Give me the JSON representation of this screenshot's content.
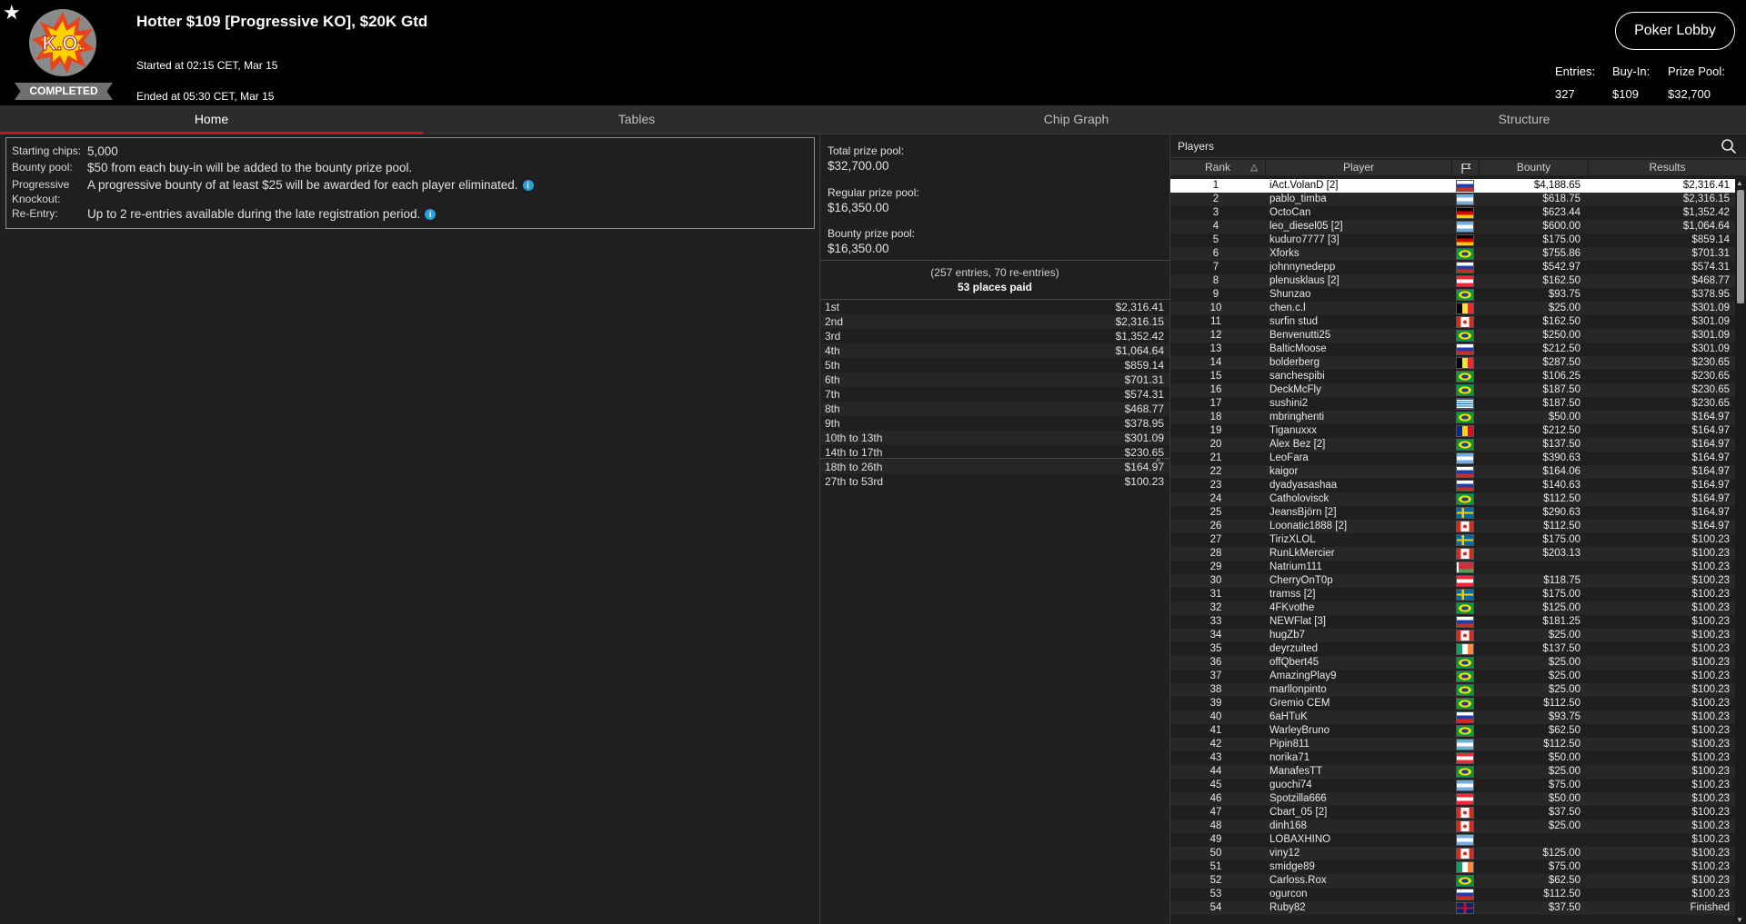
{
  "header": {
    "title": "Hotter $109 [Progressive KO], $20K Gtd",
    "started": "Started at 02:15 CET, Mar 15",
    "ended": "Ended at 05:30 CET, Mar 15",
    "status": "COMPLETED",
    "logo_text": "K.O.",
    "lobby_button": "Poker Lobby",
    "entries_label": "Entries:",
    "entries_value": "327",
    "buyin_label": "Buy-In:",
    "buyin_value": "$109",
    "prizepool_label": "Prize Pool:",
    "prizepool_value": "$32,700"
  },
  "tabs": [
    {
      "label": "Home",
      "active": true
    },
    {
      "label": "Tables",
      "active": false
    },
    {
      "label": "Chip Graph",
      "active": false
    },
    {
      "label": "Structure",
      "active": false
    }
  ],
  "info": {
    "starting_chips_label": "Starting chips:",
    "starting_chips_value": "5,000",
    "bounty_pool_label": "Bounty pool:",
    "bounty_pool_value": "$50 from each buy-in will be added to the bounty prize pool.",
    "pko_label_1": "Progressive",
    "pko_label_2": "Knockout:",
    "pko_value": "A progressive bounty of at least $25 will be awarded for each player eliminated.",
    "reentry_label": "Re-Entry:",
    "reentry_value": "Up to 2 re-entries available during the late registration period.",
    "info_icon": "i"
  },
  "prize": {
    "total_label": "Total prize pool:",
    "total_value": "$32,700.00",
    "regular_label": "Regular prize pool:",
    "regular_value": "$16,350.00",
    "bounty_label": "Bounty prize pool:",
    "bounty_value": "$16,350.00",
    "entries_text": "(257 entries, 70 re-entries)",
    "places_text": "53 places paid",
    "collapse_icon": "^",
    "payouts": [
      {
        "place": "1st",
        "amount": "$2,316.41"
      },
      {
        "place": "2nd",
        "amount": "$2,316.15"
      },
      {
        "place": "3rd",
        "amount": "$1,352.42"
      },
      {
        "place": "4th",
        "amount": "$1,064.64"
      },
      {
        "place": "5th",
        "amount": "$859.14"
      },
      {
        "place": "6th",
        "amount": "$701.31"
      },
      {
        "place": "7th",
        "amount": "$574.31"
      },
      {
        "place": "8th",
        "amount": "$468.77"
      },
      {
        "place": "9th",
        "amount": "$378.95"
      },
      {
        "place": "10th to 13th",
        "amount": "$301.09"
      },
      {
        "place": "14th to 17th",
        "amount": "$230.65"
      },
      {
        "place": "18th to 26th",
        "amount": "$164.97"
      },
      {
        "place": "27th to 53rd",
        "amount": "$100.23"
      }
    ]
  },
  "players": {
    "title": "Players",
    "col_rank": "Rank",
    "col_player": "Player",
    "col_bounty": "Bounty",
    "col_results": "Results",
    "rows": [
      {
        "rank": "1",
        "name": "iAct.VolanD [2]",
        "flag": "ru",
        "bounty": "$4,188.65",
        "result": "$2,316.41"
      },
      {
        "rank": "2",
        "name": "pablo_timba",
        "flag": "ar",
        "bounty": "$618.75",
        "result": "$2,316.15"
      },
      {
        "rank": "3",
        "name": "OctoCan",
        "flag": "de",
        "bounty": "$623.44",
        "result": "$1,352.42"
      },
      {
        "rank": "4",
        "name": "leo_diesel05 [2]",
        "flag": "ar",
        "bounty": "$600.00",
        "result": "$1,064.64"
      },
      {
        "rank": "5",
        "name": "kuduro7777 [3]",
        "flag": "de",
        "bounty": "$175.00",
        "result": "$859.14"
      },
      {
        "rank": "6",
        "name": "Xforks",
        "flag": "br",
        "bounty": "$755.86",
        "result": "$701.31"
      },
      {
        "rank": "7",
        "name": "johnnynedepp",
        "flag": "ru",
        "bounty": "$542.97",
        "result": "$574.31"
      },
      {
        "rank": "8",
        "name": "plenusklaus [2]",
        "flag": "at",
        "bounty": "$162.50",
        "result": "$468.77"
      },
      {
        "rank": "9",
        "name": "Shunzao",
        "flag": "br",
        "bounty": "$93.75",
        "result": "$378.95"
      },
      {
        "rank": "10",
        "name": "chen.c.l",
        "flag": "be",
        "bounty": "$25.00",
        "result": "$301.09"
      },
      {
        "rank": "11",
        "name": "surfin stud",
        "flag": "ca",
        "bounty": "$162.50",
        "result": "$301.09"
      },
      {
        "rank": "12",
        "name": "Benvenutti25",
        "flag": "br",
        "bounty": "$250.00",
        "result": "$301.09"
      },
      {
        "rank": "13",
        "name": "BalticMoose",
        "flag": "ru",
        "bounty": "$212.50",
        "result": "$301.09"
      },
      {
        "rank": "14",
        "name": "bolderberg",
        "flag": "be",
        "bounty": "$287.50",
        "result": "$230.65"
      },
      {
        "rank": "15",
        "name": "sanchespibi",
        "flag": "br",
        "bounty": "$106.25",
        "result": "$230.65"
      },
      {
        "rank": "16",
        "name": "DeckMcFly",
        "flag": "br",
        "bounty": "$187.50",
        "result": "$230.65"
      },
      {
        "rank": "17",
        "name": "sushini2",
        "flag": "gr",
        "bounty": "$187.50",
        "result": "$230.65"
      },
      {
        "rank": "18",
        "name": "mbringhenti",
        "flag": "br",
        "bounty": "$50.00",
        "result": "$164.97"
      },
      {
        "rank": "19",
        "name": "Tiganuxxx",
        "flag": "ro",
        "bounty": "$212.50",
        "result": "$164.97"
      },
      {
        "rank": "20",
        "name": "Alex Bez [2]",
        "flag": "br",
        "bounty": "$137.50",
        "result": "$164.97"
      },
      {
        "rank": "21",
        "name": "LeoFara",
        "flag": "ar",
        "bounty": "$390.63",
        "result": "$164.97"
      },
      {
        "rank": "22",
        "name": "kaigor",
        "flag": "ru",
        "bounty": "$164.06",
        "result": "$164.97"
      },
      {
        "rank": "23",
        "name": "dyadyasashaa",
        "flag": "ru",
        "bounty": "$140.63",
        "result": "$164.97"
      },
      {
        "rank": "24",
        "name": "Catholovisck",
        "flag": "br",
        "bounty": "$112.50",
        "result": "$164.97"
      },
      {
        "rank": "25",
        "name": "JeansBjörn [2]",
        "flag": "se",
        "bounty": "$290.63",
        "result": "$164.97"
      },
      {
        "rank": "26",
        "name": "Loonatic1888 [2]",
        "flag": "ca",
        "bounty": "$112.50",
        "result": "$164.97"
      },
      {
        "rank": "27",
        "name": "TirizXLOL",
        "flag": "se",
        "bounty": "$175.00",
        "result": "$100.23"
      },
      {
        "rank": "28",
        "name": "RunLkMercier",
        "flag": "ca",
        "bounty": "$203.13",
        "result": "$100.23"
      },
      {
        "rank": "29",
        "name": "Natrium111",
        "flag": "by",
        "bounty": "",
        "result": "$100.23"
      },
      {
        "rank": "30",
        "name": "CherryOnT0p",
        "flag": "at",
        "bounty": "$118.75",
        "result": "$100.23"
      },
      {
        "rank": "31",
        "name": "tramss [2]",
        "flag": "se",
        "bounty": "$175.00",
        "result": "$100.23"
      },
      {
        "rank": "32",
        "name": "4FKvothe",
        "flag": "br",
        "bounty": "$125.00",
        "result": "$100.23"
      },
      {
        "rank": "33",
        "name": "NEWFlat [3]",
        "flag": "ru",
        "bounty": "$181.25",
        "result": "$100.23"
      },
      {
        "rank": "34",
        "name": "hugZb7",
        "flag": "ca",
        "bounty": "$25.00",
        "result": "$100.23"
      },
      {
        "rank": "35",
        "name": "deyrzuited",
        "flag": "ie",
        "bounty": "$137.50",
        "result": "$100.23"
      },
      {
        "rank": "36",
        "name": "offQbert45",
        "flag": "br",
        "bounty": "$25.00",
        "result": "$100.23"
      },
      {
        "rank": "37",
        "name": "AmazingPlay9",
        "flag": "br",
        "bounty": "$25.00",
        "result": "$100.23"
      },
      {
        "rank": "38",
        "name": "marllonpinto",
        "flag": "br",
        "bounty": "$25.00",
        "result": "$100.23"
      },
      {
        "rank": "39",
        "name": "Gremio CEM",
        "flag": "br",
        "bounty": "$112.50",
        "result": "$100.23"
      },
      {
        "rank": "40",
        "name": "6aHTuK",
        "flag": "ru",
        "bounty": "$93.75",
        "result": "$100.23"
      },
      {
        "rank": "41",
        "name": "WarleyBruno",
        "flag": "br",
        "bounty": "$62.50",
        "result": "$100.23"
      },
      {
        "rank": "42",
        "name": "Pipin811",
        "flag": "ar",
        "bounty": "$112.50",
        "result": "$100.23"
      },
      {
        "rank": "43",
        "name": "norika71",
        "flag": "at",
        "bounty": "$50.00",
        "result": "$100.23"
      },
      {
        "rank": "44",
        "name": "ManafesTT",
        "flag": "br",
        "bounty": "$25.00",
        "result": "$100.23"
      },
      {
        "rank": "45",
        "name": "guochi74",
        "flag": "ar",
        "bounty": "$75.00",
        "result": "$100.23"
      },
      {
        "rank": "46",
        "name": "Spotzilla666",
        "flag": "at",
        "bounty": "$50.00",
        "result": "$100.23"
      },
      {
        "rank": "47",
        "name": "Cbart_05 [2]",
        "flag": "ca",
        "bounty": "$37.50",
        "result": "$100.23"
      },
      {
        "rank": "48",
        "name": "dinh168",
        "flag": "ca",
        "bounty": "$25.00",
        "result": "$100.23"
      },
      {
        "rank": "49",
        "name": "LOBAXHINO",
        "flag": "ar",
        "bounty": "",
        "result": "$100.23"
      },
      {
        "rank": "50",
        "name": "viny12",
        "flag": "ca",
        "bounty": "$125.00",
        "result": "$100.23"
      },
      {
        "rank": "51",
        "name": "smidge89",
        "flag": "ie",
        "bounty": "$75.00",
        "result": "$100.23"
      },
      {
        "rank": "52",
        "name": "Carloss.Rox",
        "flag": "br",
        "bounty": "$62.50",
        "result": "$100.23"
      },
      {
        "rank": "53",
        "name": "ogurcon",
        "flag": "ru",
        "bounty": "$112.50",
        "result": "$100.23"
      },
      {
        "rank": "54",
        "name": "Ruby82",
        "flag": "gb",
        "bounty": "$37.50",
        "result": "Finished"
      }
    ]
  },
  "colors": {
    "accent_red": "#c8102e",
    "header_bg": "#000000",
    "panel_bg": "#1f1f1f",
    "info_blue": "#2a9fd8"
  }
}
